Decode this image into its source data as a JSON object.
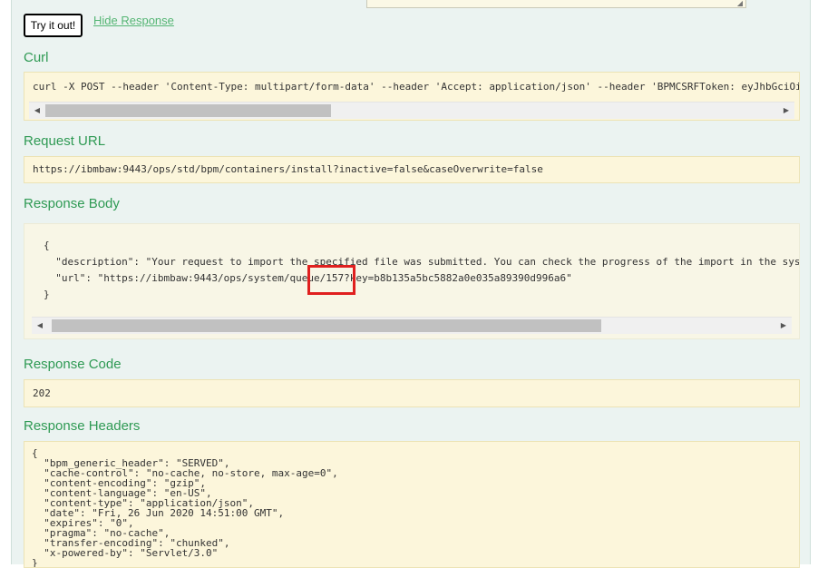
{
  "top": {
    "try_button": "Try it out!",
    "hide_link": "Hide Response"
  },
  "curl": {
    "heading": "Curl",
    "command": "curl -X POST --header 'Content-Type: multipart/form-data' --header 'Accept: application/json' --header 'BPMCSRFToken: eyJhbGciOiJI"
  },
  "request_url": {
    "heading": "Request URL",
    "value": "https://ibmbaw:9443/ops/std/bpm/containers/install?inactive=false&caseOverwrite=false"
  },
  "response_body": {
    "heading": "Response Body",
    "lines": [
      "{",
      "  \"description\": \"Your request to import the specified file was submitted. You can check the progress of the import in the syst",
      "  \"url\": \"https://ibmbaw:9443/ops/system/queue/157?key=b8b135a5bc5882a0e035a89390d996a6\"",
      "}"
    ]
  },
  "response_code": {
    "heading": "Response Code",
    "value": "202"
  },
  "response_headers": {
    "heading": "Response Headers",
    "lines": [
      "{",
      "  \"bpm_generic_header\": \"SERVED\",",
      "  \"cache-control\": \"no-cache, no-store, max-age=0\",",
      "  \"content-encoding\": \"gzip\",",
      "  \"content-language\": \"en-US\",",
      "  \"content-type\": \"application/json\",",
      "  \"date\": \"Fri, 26 Jun 2020 14:51:00 GMT\",",
      "  \"expires\": \"0\",",
      "  \"pragma\": \"no-cache\",",
      "  \"transfer-encoding\": \"chunked\",",
      "  \"x-powered-by\": \"Servlet/3.0\"",
      "}"
    ]
  },
  "icons": {
    "scroll_left": "◀",
    "scroll_right": "▶",
    "resize_grip": "◢"
  },
  "colors": {
    "panel_bg": "#ebf3f1",
    "heading": "#2f9a54",
    "link": "#55b574",
    "code_bg": "#fcf6db",
    "highlight": "#e0201f"
  }
}
